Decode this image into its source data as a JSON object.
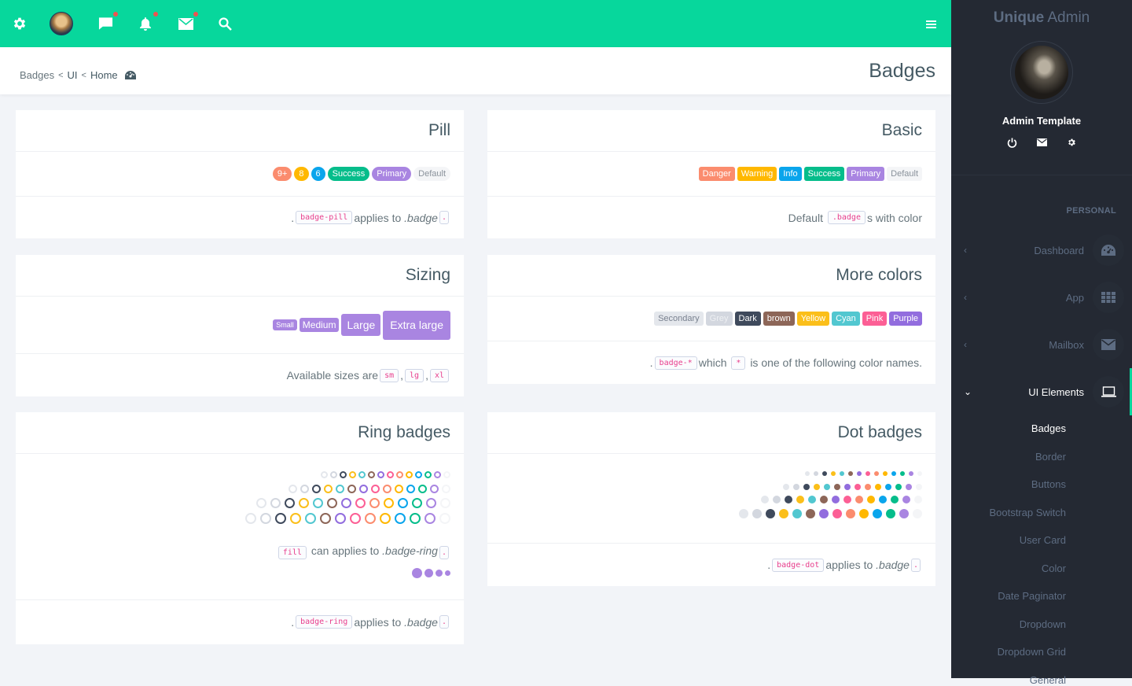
{
  "topbar": {
    "icons": [
      "gear-icon",
      "avatar",
      "chat-icon",
      "bell-icon",
      "mail-icon",
      "search-icon"
    ],
    "menu_icon": "hamburger-icon",
    "accent": "#07d79c"
  },
  "breadcrumb": {
    "items": [
      "Badges",
      "UI",
      "Home"
    ],
    "home_icon": "dashboard-icon"
  },
  "page_title": "Badges",
  "cards": {
    "pill": {
      "title": "Pill",
      "badges": [
        {
          "label": "9+",
          "color": "#fb8c6e"
        },
        {
          "label": "8",
          "color": "#ffb800"
        },
        {
          "label": "6",
          "color": "#0aa5ec"
        },
        {
          "label": "Success",
          "color": "#06bd8b"
        },
        {
          "label": "Primary",
          "color": "#a985e1"
        },
        {
          "label": "Default",
          "color": "#f4f5f7",
          "text": "#8a929b"
        }
      ],
      "footer": {
        "pre": ".",
        "code": "badge-pill",
        "mid": " applies to ",
        "em": ".badge",
        "post": "."
      }
    },
    "basic": {
      "title": "Basic",
      "badges": [
        {
          "label": "Danger",
          "color": "#fb8c6e"
        },
        {
          "label": "Warning",
          "color": "#ffb800"
        },
        {
          "label": "Info",
          "color": "#0aa5ec"
        },
        {
          "label": "Success",
          "color": "#06bd8b"
        },
        {
          "label": "Primary",
          "color": "#a985e1"
        },
        {
          "label": "Default",
          "color": "#f4f5f7",
          "text": "#8a929b"
        }
      ],
      "footer": {
        "pre": "Default ",
        "code": ".badge",
        "post": "s with color"
      }
    },
    "sizing": {
      "title": "Sizing",
      "badges": [
        {
          "label": "Small",
          "size": "sm"
        },
        {
          "label": "Medium",
          "size": "md"
        },
        {
          "label": "Large",
          "size": "lg"
        },
        {
          "label": "Extra large",
          "size": "xl"
        }
      ],
      "color": "#a985e1",
      "footer": {
        "pre": "Available sizes are ",
        "codes": [
          "sm",
          "lg",
          "xl"
        ]
      }
    },
    "more_colors": {
      "title": "More colors",
      "badges": [
        {
          "label": "Secondary",
          "color": "#e4e7ec",
          "text": "#7a8290"
        },
        {
          "label": "Grey",
          "color": "#d3d7df",
          "text": "#eef0f3"
        },
        {
          "label": "Dark",
          "color": "#3f4a5c"
        },
        {
          "label": "brown",
          "color": "#8d6658"
        },
        {
          "label": "Yellow",
          "color": "#fbbf1a"
        },
        {
          "label": "Cyan",
          "color": "#52c7d0"
        },
        {
          "label": "Pink",
          "color": "#fc5f95"
        },
        {
          "label": "Purple",
          "color": "#926dde"
        }
      ],
      "footer": {
        "pre": ".",
        "code": "badge-*",
        "mid": " which ",
        "code2": "*",
        "post": " is one of the following color names."
      }
    },
    "ring": {
      "title": "Ring badges",
      "colors": [
        "#e4e7ec",
        "#d3d7df",
        "#3f4a5c",
        "#fbbf1a",
        "#52c7d0",
        "#8d6658",
        "#926dde",
        "#fc5f95",
        "#fb8c6e",
        "#ffb800",
        "#0aa5ec",
        "#06bd8b",
        "#a985e1",
        "#f4f5f7"
      ],
      "fill_note": {
        "code": "fill",
        "mid": " can applies to ",
        "em": ".badge-ring",
        "post": "."
      },
      "fill_color": "#a985e1",
      "footer": {
        "pre": ".",
        "code": "badge-ring",
        "mid": " applies to ",
        "em": ".badge",
        "post": "."
      }
    },
    "dot": {
      "title": "Dot badges",
      "colors": [
        "#e4e7ec",
        "#d3d7df",
        "#3f4a5c",
        "#fbbf1a",
        "#52c7d0",
        "#8d6658",
        "#926dde",
        "#fc5f95",
        "#fb8c6e",
        "#ffb800",
        "#0aa5ec",
        "#06bd8b",
        "#a985e1",
        "#f4f5f7"
      ],
      "footer": {
        "pre": ".",
        "code": "badge-dot",
        "mid": " applies to ",
        "em": ".badge",
        "post": "."
      }
    }
  },
  "sidebar": {
    "brand_bold": "Unique",
    "brand_light": " Admin",
    "profile_name": "Admin Template",
    "profile_actions": [
      "power-icon",
      "mail-icon",
      "gear-icon"
    ],
    "section": "PERSONAL",
    "nav": [
      {
        "label": "Dashboard",
        "icon": "dashboard-icon",
        "arrow": "‹"
      },
      {
        "label": "App",
        "icon": "grid-icon",
        "arrow": "‹"
      },
      {
        "label": "Mailbox",
        "icon": "mail-icon",
        "arrow": "‹"
      },
      {
        "label": "UI Elements",
        "icon": "laptop-icon",
        "arrow": "⌄",
        "active": true
      }
    ],
    "sub_items": [
      "Badges",
      "Border",
      "Buttons",
      "Bootstrap Switch",
      "User Card",
      "Color",
      "Date Paginator",
      "Dropdown",
      "Dropdown Grid",
      "General"
    ],
    "active_sub": "Badges"
  }
}
